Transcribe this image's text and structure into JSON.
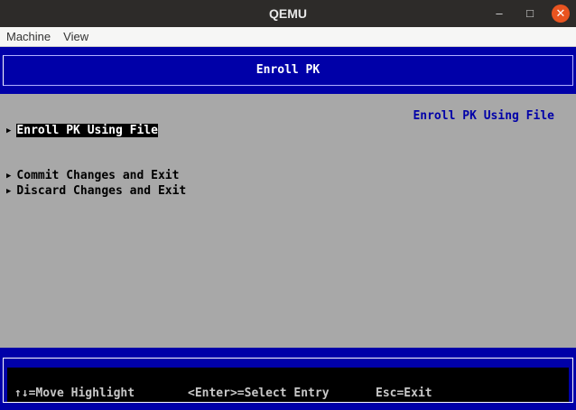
{
  "window": {
    "title": "QEMU",
    "minimize": "–",
    "maximize": "□",
    "close": "✕"
  },
  "menu": [
    "Machine",
    "View"
  ],
  "header": {
    "title": "Enroll PK"
  },
  "main": {
    "items": [
      {
        "label": "Enroll PK Using File",
        "selected": true
      },
      {
        "label": "Commit Changes and Exit"
      },
      {
        "label": "Discard Changes and Exit"
      }
    ],
    "help_text": "Enroll PK Using File"
  },
  "footer": {
    "move": "↑↓=Move Highlight",
    "select": "<Enter>=Select Entry",
    "exit": "Esc=Exit"
  },
  "colors": {
    "blue": "#0000a8",
    "gray": "#a8a8a8",
    "highlight": "#000000"
  }
}
